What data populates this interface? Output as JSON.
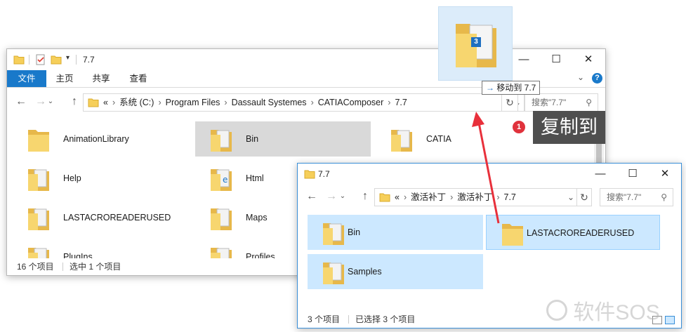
{
  "window1": {
    "title": "7.7",
    "tabs": [
      "文件",
      "主页",
      "共享",
      "查看"
    ],
    "breadcrumb": [
      "«",
      "系统 (C:)",
      "Program Files",
      "Dassault Systemes",
      "CATIAComposer",
      "7.7"
    ],
    "search_placeholder": "搜索\"7.7\"",
    "files": [
      {
        "name": "AnimationLibrary",
        "selected": false
      },
      {
        "name": "Bin",
        "selected": true
      },
      {
        "name": "CATIA",
        "selected": false
      },
      {
        "name": "Help",
        "selected": false
      },
      {
        "name": "Html",
        "selected": false
      },
      {
        "name": "LASTACROREADERUSED",
        "selected": false
      },
      {
        "name": "Maps",
        "selected": false
      },
      {
        "name": "PlugIns",
        "selected": false
      },
      {
        "name": "Profiles",
        "selected": false
      }
    ],
    "status_count": "16 个项目",
    "status_selected": "选中 1 个项目"
  },
  "window2": {
    "title": "7.7",
    "breadcrumb": [
      "«",
      "激活补丁",
      "激活补丁",
      "7.7"
    ],
    "search_placeholder": "搜索\"7.7\"",
    "files": [
      {
        "name": "Bin",
        "selected": true
      },
      {
        "name": "LASTACROREADERUSED",
        "selected": true
      },
      {
        "name": "Samples",
        "selected": true
      }
    ],
    "status_count": "3 个项目",
    "status_selected": "已选择 3 个项目"
  },
  "drag": {
    "badge_count": "3",
    "tooltip": "移动到 7.7"
  },
  "annotation": {
    "step_number": "1",
    "label": "复制到"
  },
  "watermark": "软件SOS",
  "colors": {
    "accent": "#1979ca",
    "selected_gray": "#d9d9d9",
    "selected_blue": "#cce8ff",
    "annotation_bg": "#4f4f4f",
    "step_red": "#e0323c",
    "arrow_red": "#e8303b"
  }
}
